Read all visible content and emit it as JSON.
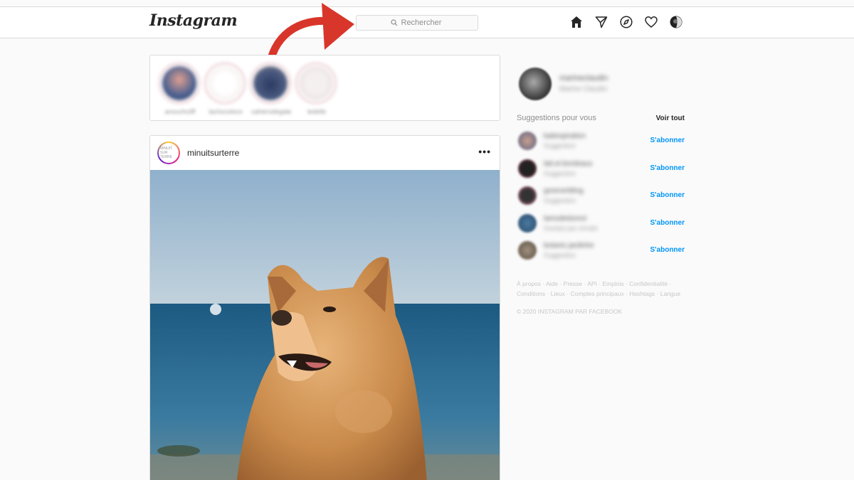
{
  "header": {
    "logo": "Instagram",
    "search_placeholder": "Rechercher",
    "icons": [
      "home-icon",
      "direct-icon",
      "explore-icon",
      "activity-icon",
      "profile-icon"
    ]
  },
  "stories": [
    {
      "username": "anouchcliff"
    },
    {
      "username": "lachocoloco"
    },
    {
      "username": "cahiersdegala"
    },
    {
      "username": "ledelle"
    }
  ],
  "post": {
    "username": "minuitsurterre",
    "avatar_text": "MINUIT SUR TERRE",
    "more": "•••"
  },
  "sidebar": {
    "me": {
      "username": "marineclaudin",
      "fullname": "Marine Claudin"
    },
    "suggestions_title": "Suggestions pour vous",
    "see_all": "Voir tout",
    "suggestions": [
      {
        "username": "katiespiration",
        "meta": "Suggestion",
        "action": "S'abonner"
      },
      {
        "username": "lait.et.bordeaux",
        "meta": "Suggestion",
        "action": "S'abonner"
      },
      {
        "username": "greenerbling",
        "meta": "Suggestion",
        "action": "S'abonner"
      },
      {
        "username": "lamodedumoi",
        "meta": "Suivi(e) par chrolet",
        "action": "S'abonner"
      },
      {
        "username": "botanic.jardinhe",
        "meta": "Suggestion",
        "action": "S'abonner"
      }
    ],
    "footer_links": "À propos · Aide · Presse · API · Emplois · Confidentialité · Conditions · Lieux · Comptes principaux · Hashtags · Langue",
    "copyright": "© 2020 INSTAGRAM PAR FACEBOOK"
  },
  "colors": {
    "link_blue": "#0095f6",
    "arrow_red": "#d8362a",
    "border": "#dbdbdb"
  }
}
